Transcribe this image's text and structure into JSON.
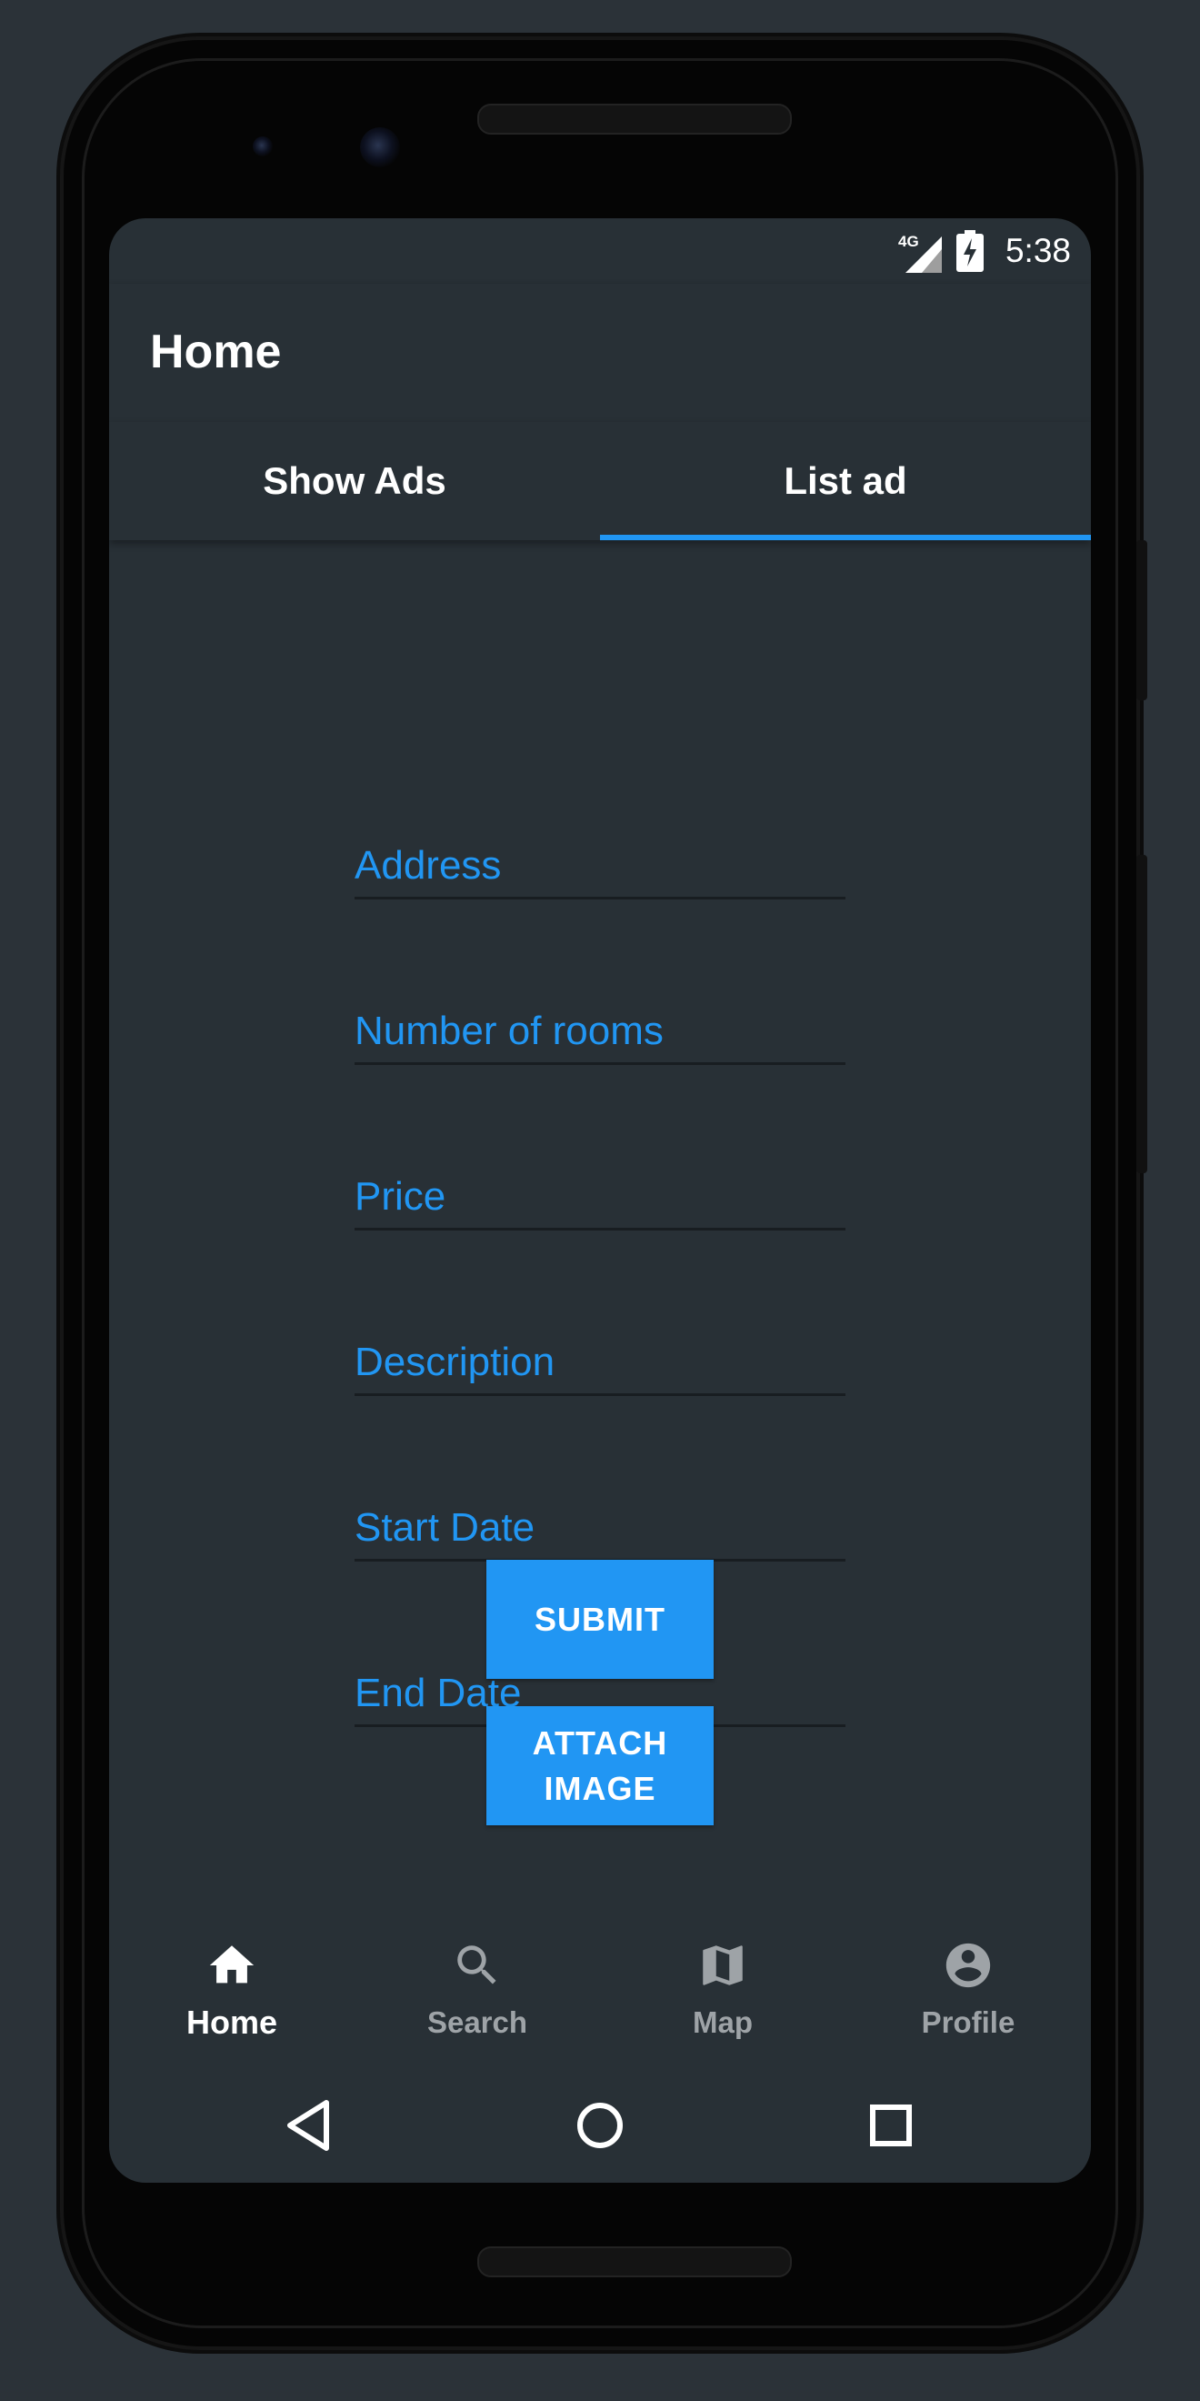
{
  "status_bar": {
    "network": "4G",
    "time": "5:38"
  },
  "app_bar": {
    "title": "Home"
  },
  "tabs": [
    {
      "label": "Show Ads",
      "selected": false
    },
    {
      "label": "List ad",
      "selected": true
    }
  ],
  "form": {
    "fields": [
      {
        "placeholder": "Address",
        "value": ""
      },
      {
        "placeholder": "Number of rooms",
        "value": ""
      },
      {
        "placeholder": "Price",
        "value": ""
      },
      {
        "placeholder": "Description",
        "value": ""
      },
      {
        "placeholder": "Start Date",
        "value": ""
      },
      {
        "placeholder": "End Date",
        "value": ""
      }
    ],
    "submit_label": "SUBMIT",
    "attach_label_line1": "ATTACH",
    "attach_label_line2": "IMAGE"
  },
  "bottom_nav": {
    "items": [
      {
        "label": "Home",
        "icon": "home-icon",
        "active": true
      },
      {
        "label": "Search",
        "icon": "search-icon",
        "active": false
      },
      {
        "label": "Map",
        "icon": "map-icon",
        "active": false
      },
      {
        "label": "Profile",
        "icon": "profile-icon",
        "active": false
      }
    ]
  },
  "colors": {
    "accent": "#2196f3",
    "background": "#283036",
    "outer_background": "#2b3238",
    "nav_active": "#ffffff",
    "nav_inactive": "#9ea3a7"
  }
}
